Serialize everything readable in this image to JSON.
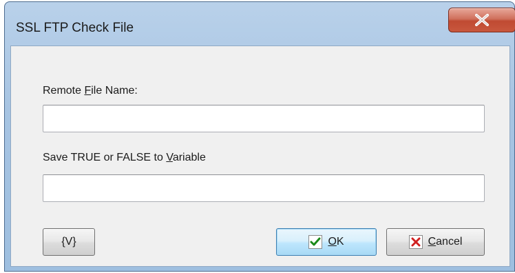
{
  "window": {
    "title": "SSL FTP Check File"
  },
  "fields": {
    "remote_file": {
      "label_pre": "Remote ",
      "label_mnemonic": "F",
      "label_post": "ile Name:",
      "value": "",
      "placeholder": ""
    },
    "variable": {
      "label_pre": "Save TRUE or FALSE to ",
      "label_mnemonic": "V",
      "label_post": "ariable",
      "value": "",
      "placeholder": ""
    }
  },
  "buttons": {
    "variable_label": "{V}",
    "ok_mnemonic": "O",
    "ok_rest": "K",
    "cancel_mnemonic": "C",
    "cancel_rest": "ancel"
  },
  "colors": {
    "ok_check": "#1a8a1a",
    "cancel_x": "#d02020",
    "close_red": "#c04a32"
  },
  "icons": [
    "close-icon",
    "checkmark-icon",
    "cancel-x-icon"
  ]
}
